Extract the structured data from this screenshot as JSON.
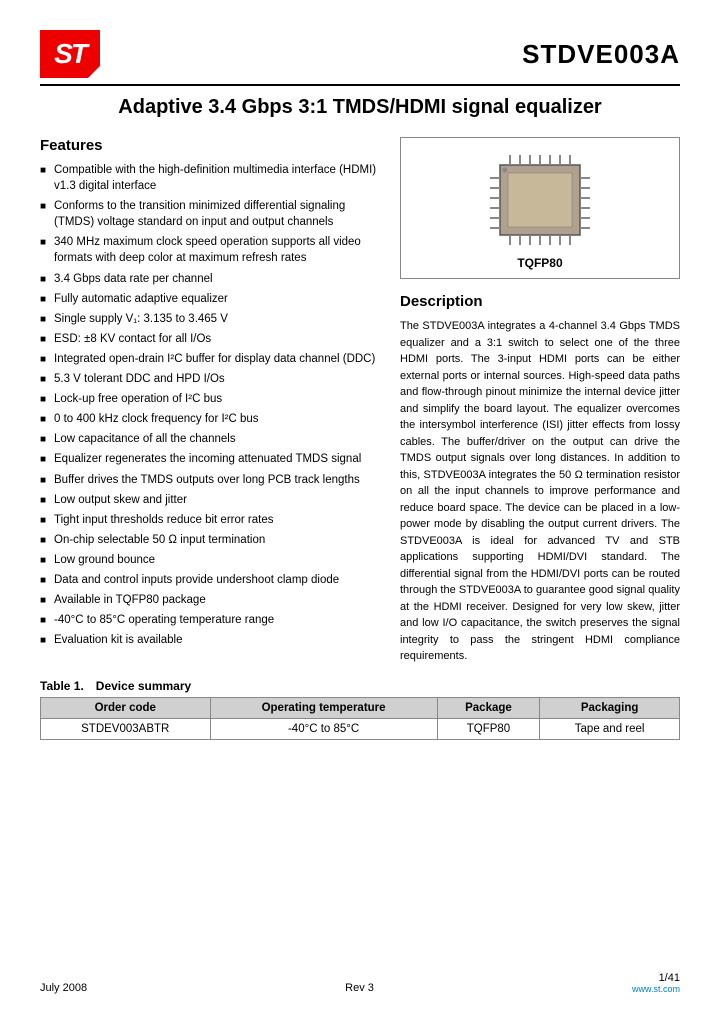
{
  "header": {
    "logo_text": "ST",
    "product_name": "STDVE003A"
  },
  "main_title": "Adaptive 3.4 Gbps 3:1 TMDS/HDMI signal equalizer",
  "features": {
    "section_title": "Features",
    "items": [
      "Compatible with the high-definition multimedia interface (HDMI) v1.3 digital interface",
      "Conforms to the transition minimized differential signaling (TMDS) voltage standard on input and output channels",
      "340 MHz maximum clock speed operation supports all video formats with deep color at maximum refresh rates",
      "3.4 Gbps data rate per channel",
      "Fully automatic adaptive equalizer",
      "Single supply V₁: 3.135 to 3.465 V",
      "ESD: ±8 KV contact for all I/Os",
      "Integrated open-drain I²C buffer for display data channel (DDC)",
      "5.3 V tolerant DDC and HPD I/Os",
      "Lock-up free operation of I²C bus",
      "0 to 400 kHz clock frequency for I²C bus",
      "Low capacitance of all the channels",
      "Equalizer regenerates the incoming attenuated TMDS signal",
      "Buffer drives the TMDS outputs over long PCB track lengths",
      "Low output skew and jitter",
      "Tight input thresholds reduce bit error rates",
      "On-chip selectable 50 Ω input termination",
      "Low ground bounce",
      "Data and control inputs provide undershoot clamp diode",
      "Available in TQFP80 package",
      "-40°C to 85°C operating temperature range",
      "Evaluation kit is available"
    ]
  },
  "ic_label": "TQFP80",
  "description": {
    "section_title": "Description",
    "text": "The STDVE003A integrates a 4-channel 3.4 Gbps TMDS equalizer and a 3:1 switch to select one of the three HDMI ports. The 3-input HDMI ports can be either external ports or internal sources. High-speed data paths and flow-through pinout minimize the internal device jitter and simplify the board layout. The equalizer overcomes the intersymbol interference (ISI) jitter effects from lossy cables. The buffer/driver on the output can drive the TMDS output signals over long distances. In addition to this, STDVE003A integrates the 50 Ω termination resistor on all the input channels to improve performance and reduce board space. The device can be placed in a low-power mode by disabling the output current drivers. The STDVE003A is ideal for advanced TV and STB applications supporting HDMI/DVI standard. The differential signal from the HDMI/DVI ports can be routed through the STDVE003A to guarantee good signal quality at the HDMI receiver. Designed for very low skew, jitter and low I/O capacitance, the switch preserves the signal integrity to pass the stringent HDMI compliance requirements."
  },
  "table": {
    "caption": "Table 1. Device summary",
    "headers": [
      "Order code",
      "Operating temperature",
      "Package",
      "Packaging"
    ],
    "rows": [
      [
        "STDEV003ABTR",
        "-40°C to 85°C",
        "TQFP80",
        "Tape and reel"
      ]
    ]
  },
  "footer": {
    "left": "July 2008",
    "center": "Rev 3",
    "right": "1/41",
    "watermark": "www.st.com"
  }
}
